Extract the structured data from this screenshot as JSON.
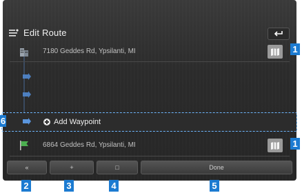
{
  "header": {
    "title": "Edit Route"
  },
  "route": {
    "start_address": "7180 Geddes Rd, Ypsilanti, MI",
    "add_waypoint_label": "Add Waypoint",
    "end_address": "6864 Geddes Rd, Ypsilanti, MI"
  },
  "bottom_bar": {
    "button1_label": "«",
    "button2_label": "+",
    "button3_label": "□",
    "done_label": "Done"
  },
  "callouts": {
    "c1_top": "1",
    "c1_bottom": "1",
    "c2": "2",
    "c3": "3",
    "c4": "4",
    "c5": "5",
    "c6": "6"
  },
  "colors": {
    "screen_bg": "#2b2b2b",
    "callout_blue": "#1c7bd1",
    "highlight_dashed": "#6fb8ff",
    "waypoint_flag": "#3f8fd8",
    "destination_flag": "#4caf50"
  }
}
